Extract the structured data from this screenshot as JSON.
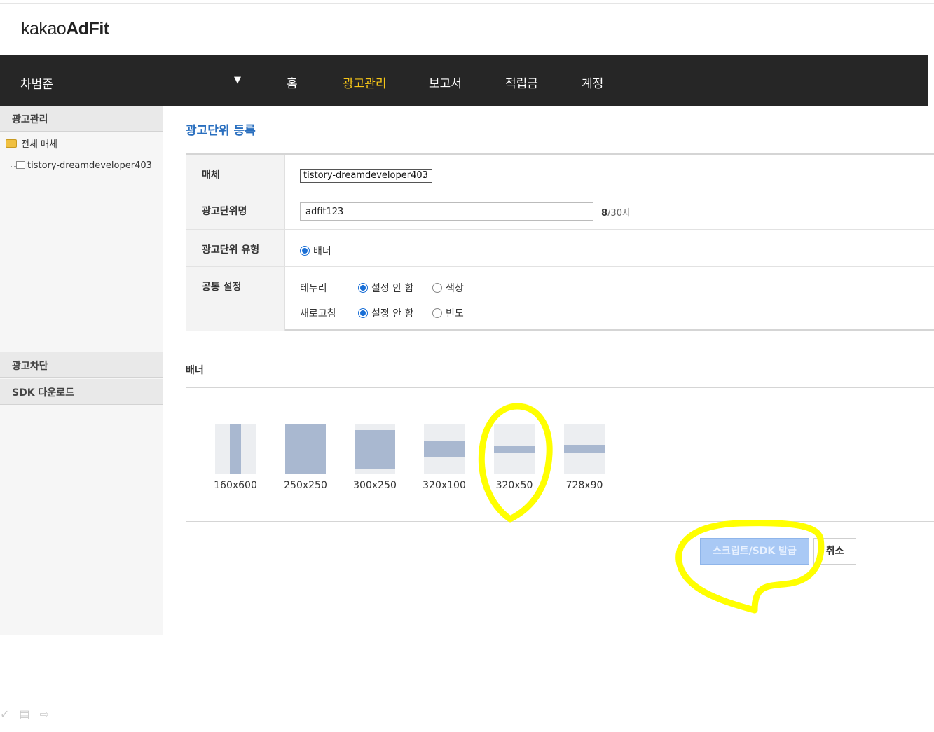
{
  "logo": {
    "prefix": "kakao",
    "suffix": "AdFit"
  },
  "navbar": {
    "user_name": "차범준",
    "items": [
      {
        "label": "홈",
        "active": false
      },
      {
        "label": "광고관리",
        "active": true
      },
      {
        "label": "보고서",
        "active": false
      },
      {
        "label": "적립금",
        "active": false
      },
      {
        "label": "계정",
        "active": false
      }
    ],
    "active_color": "#f5c518"
  },
  "sidebar": {
    "section_ad_manage": "광고관리",
    "tree_root": "전체 매체",
    "tree_child": "tistory-dreamdeveloper403",
    "section_block": "광고차단",
    "section_sdk": "SDK 다운로드"
  },
  "page": {
    "title": "광고단위 등록"
  },
  "form": {
    "media_label": "매체",
    "media_value": "tistory-dreamdeveloper403",
    "unit_name_label": "광고단위명",
    "unit_name_value": "adfit123",
    "counter_current": "8",
    "counter_max": "/30자",
    "unit_type_label": "광고단위 유형",
    "unit_type_option": "배너",
    "common_label": "공통 설정",
    "border_label": "테두리",
    "border_opt_none": "설정 안 함",
    "border_opt_color": "색상",
    "refresh_label": "새로고침",
    "refresh_opt_none": "설정 안 함",
    "refresh_opt_freq": "빈도"
  },
  "banner": {
    "title": "배너",
    "sizes": [
      "160x600",
      "250x250",
      "300x250",
      "320x100",
      "320x50",
      "728x90"
    ],
    "selected_size": "320x50"
  },
  "buttons": {
    "issue": "스크립트/SDK 발급",
    "cancel": "취소"
  },
  "colors": {
    "accent": "#2a6fbf",
    "primary_button": "#a9c9f5",
    "highlight_marker": "#ffff00"
  }
}
